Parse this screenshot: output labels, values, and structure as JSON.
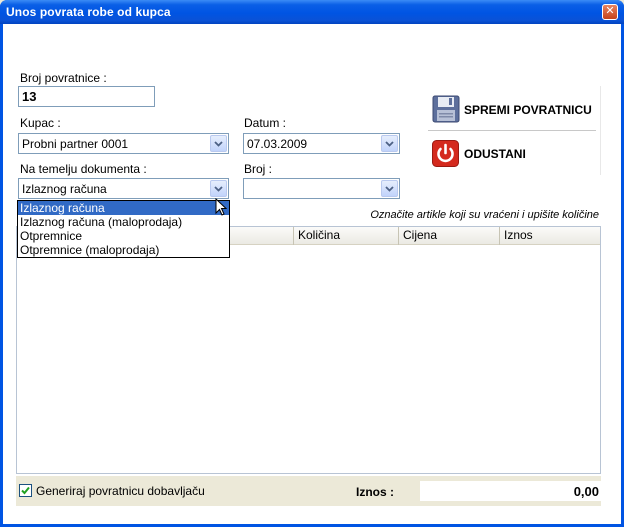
{
  "window": {
    "title": "Unos povrata robe od kupca",
    "close_glyph": "✕"
  },
  "form": {
    "broj_povratnice_label": "Broj povratnice :",
    "broj_povratnice_value": "13",
    "kupac_label": "Kupac :",
    "kupac_value": "Probni partner 0001",
    "datum_label": "Datum :",
    "datum_value": "07.03.2009",
    "temelj_label": "Na temelju dokumenta :",
    "temelj_value": "Izlaznog računa",
    "broj_label": "Broj :",
    "broj_value": ""
  },
  "dropdown": {
    "options": [
      "Izlaznog računa",
      "Izlaznog računa (maloprodaja)",
      "Otpremnice",
      "Otpremnice (maloprodaja)"
    ],
    "selected_index": 0
  },
  "actions": {
    "save_label": "SPREMI POVRATNICU",
    "save_icon": "floppy-disk-icon",
    "cancel_label": "ODUSTANI",
    "cancel_icon": "power-icon"
  },
  "hint": "Označite artikle koji su vraćeni i upišite količine",
  "grid": {
    "columns": [
      "Količina",
      "Cijena",
      "Iznos"
    ]
  },
  "footer": {
    "checkbox_label": "Generiraj povratnicu dobavljaču",
    "checkbox_checked": true,
    "total_label": "Iznos :",
    "total_value": "0,00"
  },
  "colors": {
    "titlebar": "#0054e3",
    "selection": "#316ac5",
    "cancel_red": "#d42a1e",
    "save_blue": "#5a6e9c"
  }
}
